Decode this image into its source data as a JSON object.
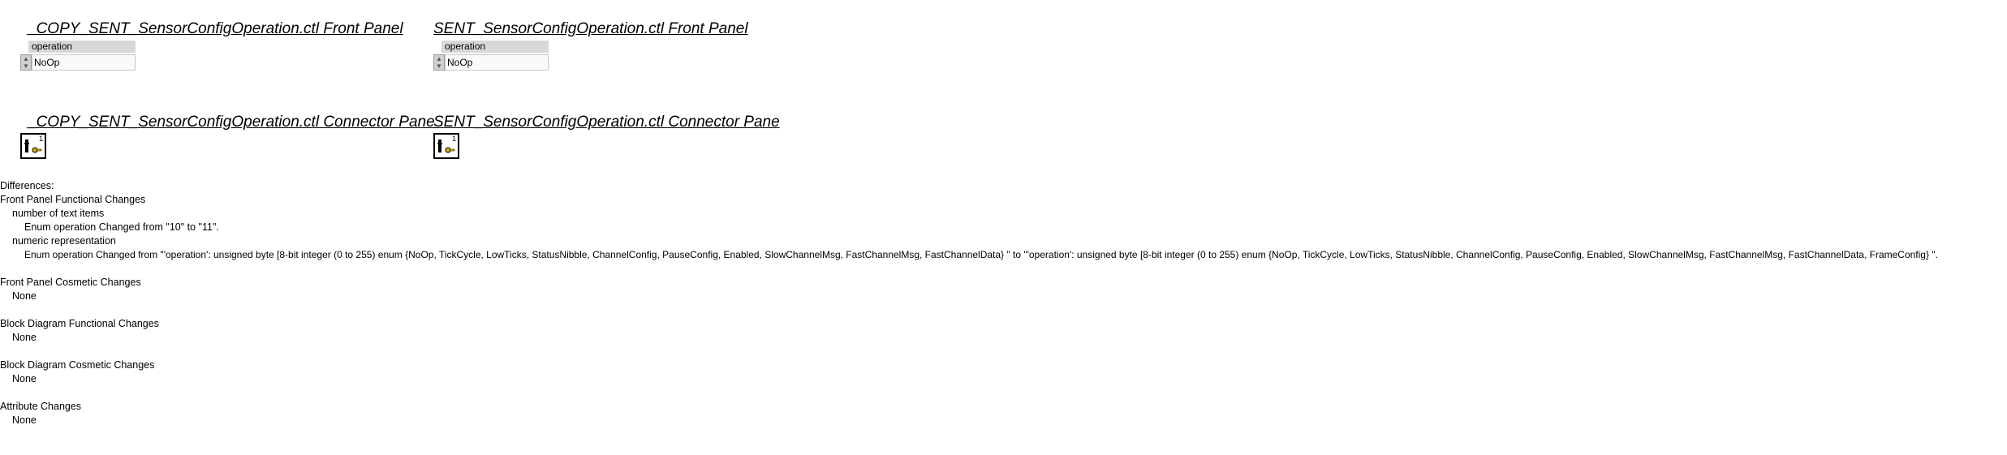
{
  "panels": [
    {
      "front_panel_title": "_COPY_SENT_SensorConfigOperation.ctl Front Panel",
      "control_label": "operation",
      "control_value": "NoOp",
      "connector_title": "_COPY_SENT_SensorConfigOperation.ctl Connector Pane",
      "connector_number": "1"
    },
    {
      "front_panel_title": "SENT_SensorConfigOperation.ctl Front Panel",
      "control_label": "operation",
      "control_value": "NoOp",
      "connector_title": "SENT_SensorConfigOperation.ctl Connector Pane",
      "connector_number": "1"
    }
  ],
  "report": {
    "differences": "Differences:",
    "fp_functional": "Front Panel Functional Changes",
    "num_text_items": "number of text items",
    "enum_changed": "Enum operation Changed from \"10\" to \"11\".",
    "numeric_repr": "numeric representation",
    "enum_repr_changed": "Enum operation Changed from \"'operation': unsigned byte [8-bit integer (0 to 255) enum {NoOp, TickCycle, LowTicks, StatusNibble, ChannelConfig, PauseConfig, Enabled, SlowChannelMsg, FastChannelMsg, FastChannelData} \" to \"'operation': unsigned byte [8-bit integer (0 to 255) enum {NoOp, TickCycle, LowTicks, StatusNibble, ChannelConfig, PauseConfig, Enabled, SlowChannelMsg, FastChannelMsg, FastChannelData, FrameConfig} \".",
    "fp_cosmetic": "Front Panel Cosmetic Changes",
    "fp_cosmetic_val": "None",
    "bd_functional": "Block Diagram Functional Changes",
    "bd_functional_val": "None",
    "bd_cosmetic": "Block Diagram Cosmetic Changes",
    "bd_cosmetic_val": "None",
    "attr_changes": "Attribute Changes",
    "attr_changes_val": "None"
  }
}
